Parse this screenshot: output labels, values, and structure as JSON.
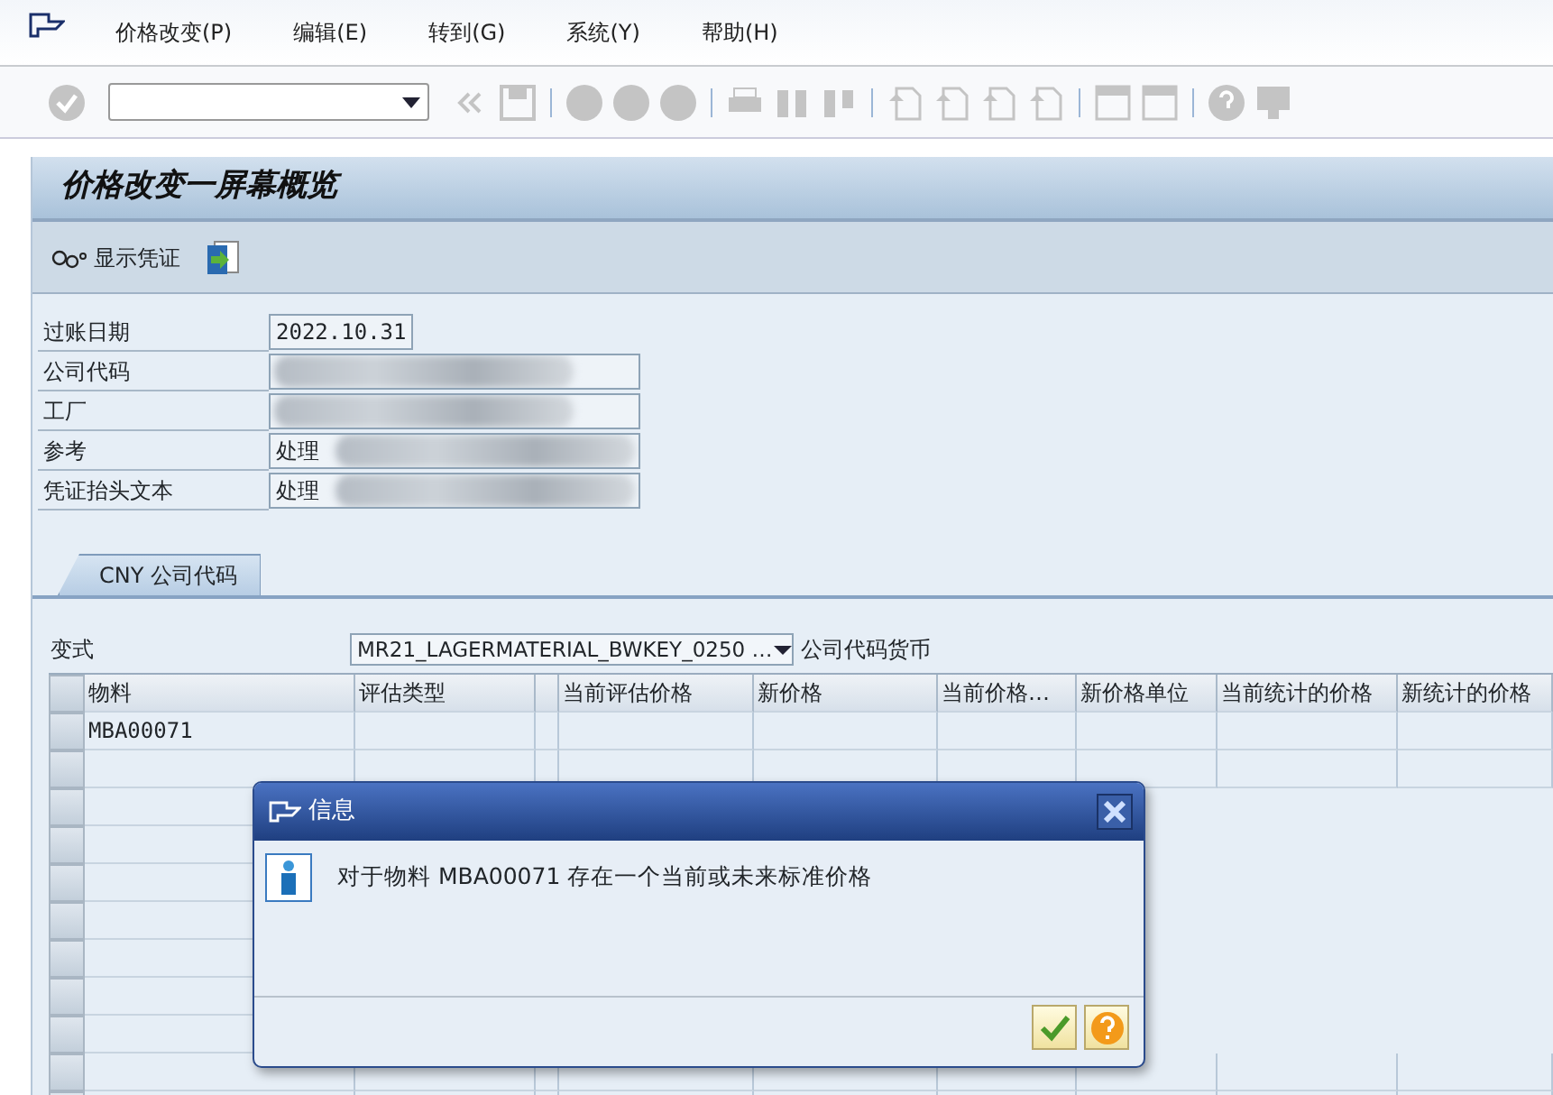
{
  "menu": [
    "价格改变(P)",
    "编辑(E)",
    "转到(G)",
    "系统(Y)",
    "帮助(H)"
  ],
  "screen_title": "价格改变一屏幕概览",
  "app_toolbar": {
    "display_document": "显示凭证"
  },
  "form": [
    {
      "label": "过账日期",
      "value": "2022.10.31",
      "redacted": false
    },
    {
      "label": "公司代码",
      "redacted": true
    },
    {
      "label": "工厂",
      "redacted": true
    },
    {
      "label": "参考",
      "value": "处理",
      "redacted": true
    },
    {
      "label": "凭证抬头文本",
      "value": "处理",
      "redacted": true
    }
  ],
  "tabs": [
    {
      "label": "CNY 公司代码",
      "selected": true
    }
  ],
  "variant": {
    "label": "变式",
    "value": "MR21_LAGERMATERIAL_BWKEY_0250 …",
    "suffix": "公司代码货币"
  },
  "table": {
    "columns": [
      "物料",
      "评估类型",
      "",
      "当前评估价格",
      "新价格",
      "当前价格…",
      "新价格单位",
      "当前统计的价格",
      "新统计的价格"
    ],
    "rows": [
      [
        "MBA00071",
        "",
        "",
        "",
        "",
        "",
        "",
        "",
        ""
      ]
    ]
  },
  "dialog": {
    "title": "信息",
    "message": "对于物料 MBA00071 存在一个当前或未来标准价格"
  }
}
